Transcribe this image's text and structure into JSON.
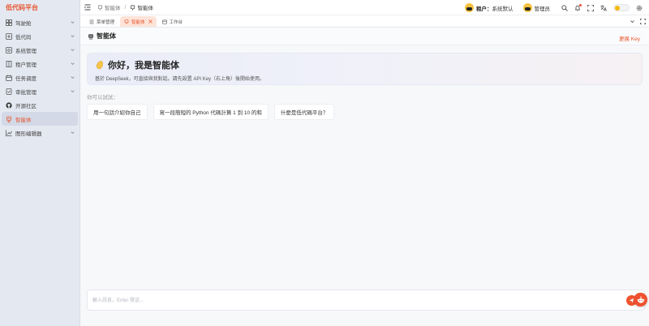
{
  "sidebar": {
    "logo": "低代码平台",
    "items": [
      {
        "label": "驾驶舱",
        "icon": "dashboard-icon",
        "has_arrow": true
      },
      {
        "label": "低代码",
        "icon": "code-icon",
        "has_arrow": true
      },
      {
        "label": "系统管理",
        "icon": "gear-icon",
        "has_arrow": true
      },
      {
        "label": "租户管理",
        "icon": "building-icon",
        "has_arrow": true
      },
      {
        "label": "任务调度",
        "icon": "calendar-icon",
        "has_arrow": true
      },
      {
        "label": "审批管理",
        "icon": "audit-icon",
        "has_arrow": true
      },
      {
        "label": "开源社区",
        "icon": "github-icon",
        "has_arrow": false
      },
      {
        "label": "智能体",
        "icon": "robot-icon",
        "has_arrow": false,
        "active": true
      },
      {
        "label": "图形编辑器",
        "icon": "chart-edit-icon",
        "has_arrow": true
      }
    ]
  },
  "header": {
    "breadcrumb": [
      {
        "label": "智能体",
        "icon": "robot-icon"
      },
      {
        "label": "智能体",
        "icon": "robot-icon"
      }
    ],
    "breadcrumb_sep": "/",
    "tenant_label": "租户：",
    "tenant_value": "系统默认",
    "user_label": "管理员"
  },
  "tabs": [
    {
      "label": "菜单管理",
      "icon": "menu-list-icon",
      "active": false
    },
    {
      "label": "智能体",
      "icon": "robot-icon",
      "active": true
    },
    {
      "label": "工作台",
      "icon": "workbench-icon",
      "active": false
    }
  ],
  "main": {
    "title": "智能体",
    "change_key": "更换 Key",
    "welcome_title": "你好，我是智能体",
    "welcome_desc": "基於 DeepSeek，可直接與我對話。請先設置 API Key（右上角）後開始使用。",
    "try_label": "你可以試試：",
    "suggestions": [
      "用一句話介紹你自己",
      "寫一段簡短的 Python 代碼計算 1 到 10 的和",
      "什麼是低代碼平台？"
    ],
    "input_placeholder": "輸入訊息，Enter 發送..."
  },
  "colors": {
    "accent": "#e8552f",
    "sidebar_bg": "#e4e8f1",
    "active_tab_bg": "#fde4d8"
  }
}
